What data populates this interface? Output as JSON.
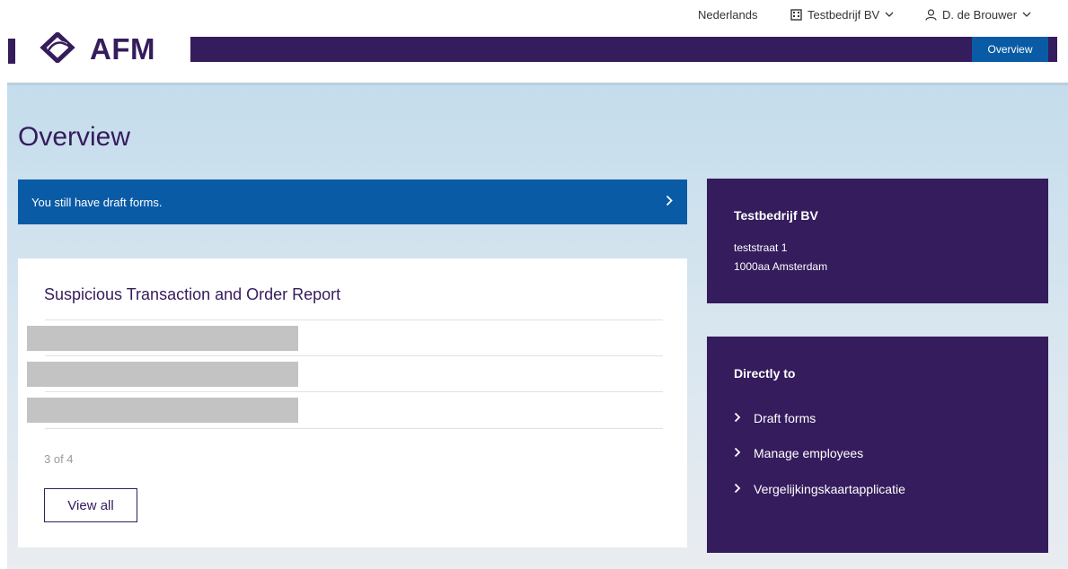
{
  "util_bar": {
    "language": "Nederlands",
    "company": "Testbedrijf BV",
    "user": "D. de Brouwer"
  },
  "brand": {
    "logo_text": "AFM",
    "nav_overview": "Overview"
  },
  "main": {
    "title": "Overview",
    "draft_banner": "You still have draft forms.",
    "report_card": {
      "title": "Suspicious Transaction and Order Report",
      "pager": "3 of 4",
      "view_all": "View all"
    }
  },
  "company_card": {
    "name": "Testbedrijf BV",
    "street": "teststraat 1",
    "city": "1000aa Amsterdam"
  },
  "direct_card": {
    "title": "Directly to",
    "links": [
      "Draft forms",
      "Manage employees",
      "Vergelijkingskaartapplicatie"
    ]
  },
  "colors": {
    "brand_purple": "#351c5c",
    "accent_blue": "#0a5ba6",
    "hero_gradient_top": "#c4dcec",
    "redacted_gray": "#c3c3c3"
  }
}
